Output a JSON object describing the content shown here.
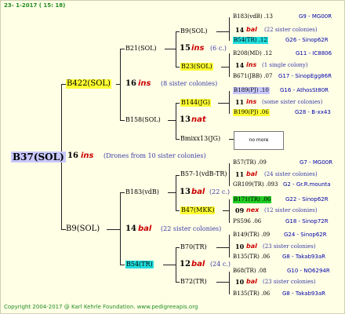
{
  "header": "23-  1-2017 ( 15: 18)",
  "footer": "Copyright 2004-2017 @ Karl Kehrle Foundation.   www.pedigreeapis.org",
  "root": {
    "name": "B37(SOL)",
    "gen": "16",
    "ins": "ins",
    "note": "(Drones from 10 sister colonies)"
  },
  "l1a": {
    "name": "B422(SOL)",
    "gen": "16",
    "ins": "ins",
    "note": "(8 sister colonies)"
  },
  "l1b": {
    "name": "B9(SOL)",
    "gen": "14",
    "ins": "bal",
    "note": "(22 sister colonies)"
  },
  "l2a": {
    "name": "B21(SOL)",
    "gen": "15",
    "ins": "ins",
    "note": "(6 c.)"
  },
  "l2b": {
    "name": "B158(SOL)",
    "gen": "13",
    "ins": "nat"
  },
  "l2c": {
    "name": "B183(vdB)",
    "gen": "13",
    "ins": "bal",
    "note": "(22 c.)"
  },
  "l2d": {
    "name": "B54(TR)",
    "gen": "12",
    "ins": "bal",
    "note": "(24 c.)"
  },
  "l3": {
    "a": "B9(SOL)",
    "b": "B23(SOL)",
    "c": "B144(JG)",
    "d": "Bmixx13(JG)",
    "e": "B57-1(vdB-TR)",
    "f": "B47(MKK)",
    "g": "B70(TR)",
    "h": "B72(TR)"
  },
  "nomore": "no more",
  "right": [
    {
      "l1": "B183(vdB) .13",
      "r1": "G9 - MG00R",
      "g": "14",
      "ins": "bal",
      "note": "(22 sister colonies)",
      "l2": "B54(TR) .12",
      "r2": "G26 - Sinop62R"
    },
    {
      "l1": "B208(MD) .12",
      "r1": "G11 - IC8806",
      "g": "14",
      "ins": "ins",
      "note": "(1 single colony)",
      "l2": "B671(JBB) .07",
      "r2": "G17 - SinopEgg86R"
    },
    {
      "l1": "B189(PJ) .10",
      "r1": "G16 - AthosSt80R",
      "g": "11",
      "ins": "ins",
      "note": "(some sister colonies)",
      "l2": "B190(PJ) .06",
      "r2": "G28 - B-xx43"
    },
    {
      "l1": "B57(TR) .09",
      "r1": "G7 - MG00R",
      "g": "11",
      "ins": "bal",
      "note": "(24 sister colonies)",
      "l2": "GR109(TR) .093",
      "r2": "G2 - Gr.R.mounta"
    },
    {
      "l1": "B171(TR) .06",
      "r1": "G22 - Sinop62R",
      "g": "09",
      "ins": "nex",
      "note": "(12 sister colonies)",
      "l2": "PS596 .06",
      "r2": "G18 - Sinop72R"
    },
    {
      "l1": "B149(TR) .09",
      "r1": "G24 - Sinop62R",
      "g": "10",
      "ins": "bal",
      "note": "(23 sister colonies)",
      "l2": "B135(TR) .06",
      "r2": "G8 - Takab93aR"
    },
    {
      "l1": "B68(TR) .08",
      "r1": "G10 - NO6294R",
      "g": "10",
      "ins": "bal",
      "note": "(23 sister colonies)",
      "l2": "B135(TR) .06",
      "r2": "G8 - Takab93aR"
    }
  ]
}
